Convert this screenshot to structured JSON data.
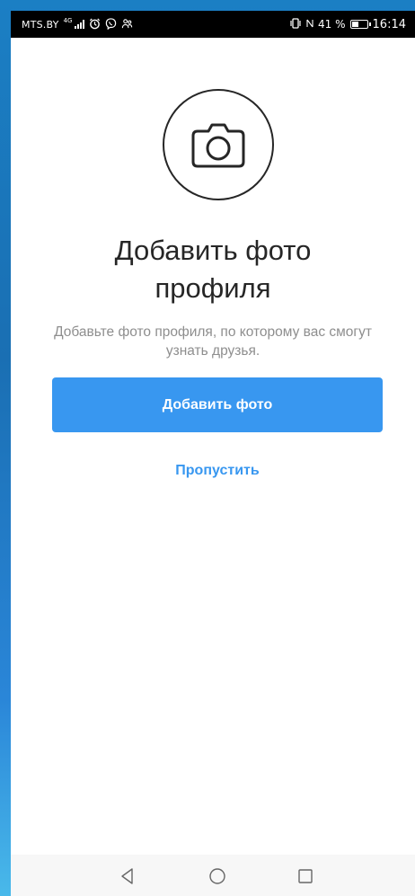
{
  "status_bar": {
    "carrier": "MTS.BY",
    "network": "4G",
    "battery_percent": "41 %",
    "time": "16:14",
    "icons": [
      "signal-icon",
      "alarm-icon",
      "viber-icon",
      "people-icon",
      "vibrate-icon",
      "nfc-icon",
      "battery-icon"
    ]
  },
  "content": {
    "title_line1": "Добавить фото",
    "title_line2": "профиля",
    "description": "Добавьте фото профиля, по которому вас смогут узнать друзья.",
    "add_photo_button": "Добавить фото",
    "skip_link": "Пропустить"
  },
  "nav_bar": {
    "icons": [
      "back-icon",
      "home-icon",
      "recents-icon"
    ]
  },
  "colors": {
    "accent": "#3897f0",
    "text_primary": "#262626",
    "text_secondary": "#8e8e8e"
  }
}
